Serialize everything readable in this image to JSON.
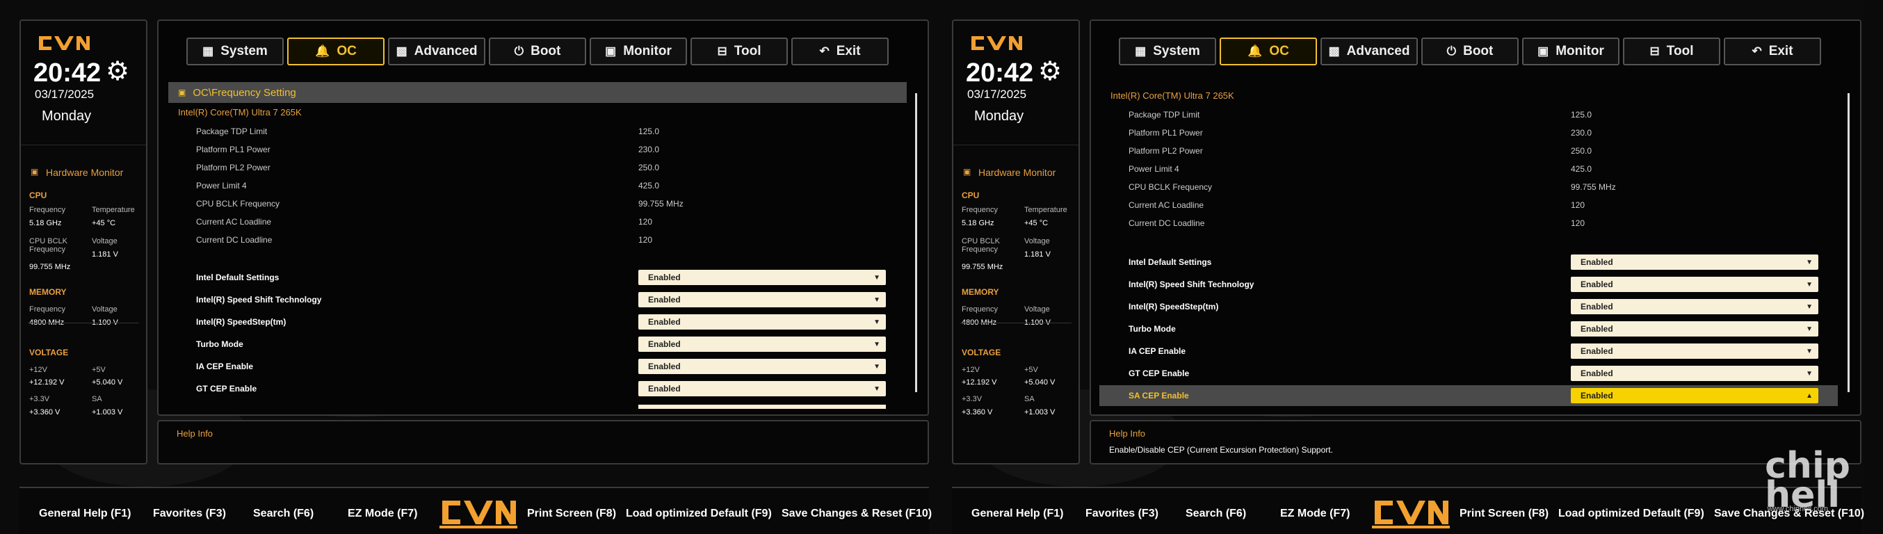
{
  "screens": [
    {
      "time": "20:42",
      "date": "03/17/2025",
      "day": "Monday",
      "hardware_monitor": {
        "title": "Hardware Monitor",
        "cpu": {
          "title": "CPU",
          "frequency_label": "Frequency",
          "frequency": "5.18 GHz",
          "temperature_label": "Temperature",
          "temperature": "+45 °C",
          "bclk_label": "CPU BCLK Frequency",
          "bclk": "99.755 MHz",
          "voltage_label": "Voltage",
          "voltage": "1.181 V"
        },
        "memory": {
          "title": "MEMORY",
          "frequency_label": "Frequency",
          "frequency": "4800 MHz",
          "voltage_label": "Voltage",
          "voltage": "1.100 V"
        },
        "voltage": {
          "title": "VOLTAGE",
          "v12_label": "+12V",
          "v12": "+12.192 V",
          "v5_label": "+5V",
          "v5": "+5.040 V",
          "v33_label": "+3.3V",
          "v33": "+3.360 V",
          "sa_label": "SA",
          "sa": "+1.003 V"
        }
      },
      "tabs": [
        "System",
        "OC",
        "Advanced",
        "Boot",
        "Monitor",
        "Tool",
        "Exit"
      ],
      "breadcrumb": "OC\\Frequency Setting",
      "cpu_name": "Intel(R) Core(TM) Ultra 7 265K",
      "info_rows": [
        {
          "label": "Package TDP Limit",
          "value": "125.0"
        },
        {
          "label": "Platform PL1 Power",
          "value": "230.0"
        },
        {
          "label": "Platform PL2 Power",
          "value": "250.0"
        },
        {
          "label": "Power Limit 4",
          "value": "425.0"
        },
        {
          "label": "CPU BCLK Frequency",
          "value": "99.755 MHz"
        },
        {
          "label": "Current AC Loadline",
          "value": "120"
        },
        {
          "label": "Current DC Loadline",
          "value": "120"
        }
      ],
      "settings": [
        {
          "label": "Intel Default Settings",
          "value": "Enabled"
        },
        {
          "label": "Intel(R) Speed Shift Technology",
          "value": "Enabled"
        },
        {
          "label": "Intel(R) SpeedStep(tm)",
          "value": "Enabled"
        },
        {
          "label": "Turbo Mode",
          "value": "Enabled"
        },
        {
          "label": "IA CEP Enable",
          "value": "Enabled"
        },
        {
          "label": "GT CEP Enable",
          "value": "Enabled"
        }
      ],
      "help_title": "Help Info",
      "help_text": "",
      "footer": [
        "General Help (F1)",
        "Favorites (F3)",
        "Search (F6)",
        "EZ Mode (F7)",
        "Print Screen (F8)",
        "Load optimized Default (F9)",
        "Save Changes & Reset (F10)"
      ]
    },
    {
      "time": "20:42",
      "date": "03/17/2025",
      "day": "Monday",
      "hardware_monitor": {
        "title": "Hardware Monitor",
        "cpu": {
          "title": "CPU",
          "frequency_label": "Frequency",
          "frequency": "5.18 GHz",
          "temperature_label": "Temperature",
          "temperature": "+45 °C",
          "bclk_label": "CPU BCLK Frequency",
          "bclk": "99.755 MHz",
          "voltage_label": "Voltage",
          "voltage": "1.181 V"
        },
        "memory": {
          "title": "MEMORY",
          "frequency_label": "Frequency",
          "frequency": "4800 MHz",
          "voltage_label": "Voltage",
          "voltage": "1.100 V"
        },
        "voltage": {
          "title": "VOLTAGE",
          "v12_label": "+12V",
          "v12": "+12.192 V",
          "v5_label": "+5V",
          "v5": "+5.040 V",
          "v33_label": "+3.3V",
          "v33": "+3.360 V",
          "sa_label": "SA",
          "sa": "+1.003 V"
        }
      },
      "tabs": [
        "System",
        "OC",
        "Advanced",
        "Boot",
        "Monitor",
        "Tool",
        "Exit"
      ],
      "breadcrumb": "",
      "cpu_name": "Intel(R) Core(TM) Ultra 7 265K",
      "info_rows": [
        {
          "label": "Package TDP Limit",
          "value": "125.0"
        },
        {
          "label": "Platform PL1 Power",
          "value": "230.0"
        },
        {
          "label": "Platform PL2 Power",
          "value": "250.0"
        },
        {
          "label": "Power Limit 4",
          "value": "425.0"
        },
        {
          "label": "CPU BCLK Frequency",
          "value": "99.755 MHz"
        },
        {
          "label": "Current AC Loadline",
          "value": "120"
        },
        {
          "label": "Current DC Loadline",
          "value": "120"
        }
      ],
      "settings": [
        {
          "label": "Intel Default Settings",
          "value": "Enabled"
        },
        {
          "label": "Intel(R) Speed Shift Technology",
          "value": "Enabled"
        },
        {
          "label": "Intel(R) SpeedStep(tm)",
          "value": "Enabled"
        },
        {
          "label": "Turbo Mode",
          "value": "Enabled"
        },
        {
          "label": "IA CEP Enable",
          "value": "Enabled"
        },
        {
          "label": "GT CEP Enable",
          "value": "Enabled"
        },
        {
          "label": "SA CEP Enable",
          "value": "Enabled"
        }
      ],
      "help_title": "Help Info",
      "help_text": "Enable/Disable CEP (Current Excursion Protection) Support.",
      "footer": [
        "General Help (F1)",
        "Favorites (F3)",
        "Search (F6)",
        "EZ Mode (F7)",
        "Print Screen (F8)",
        "Load optimized Default (F9)",
        "Save Changes & Reset (F10)"
      ]
    }
  ],
  "watermark": "www.chiphell.com",
  "logo_text": "chip hell",
  "colors": {
    "accent": "#f0c030",
    "orange": "#e8a040",
    "dropdown": "#f8f0d8",
    "selected_dropdown": "#f6d200",
    "panel_border": "#3a3a3a"
  },
  "icons": {
    "System": "grid-icon",
    "OC": "bell-icon",
    "Advanced": "chip-icon",
    "Boot": "power-icon",
    "Monitor": "monitor-icon",
    "Tool": "toolbox-icon",
    "Exit": "back-arrow-icon"
  }
}
